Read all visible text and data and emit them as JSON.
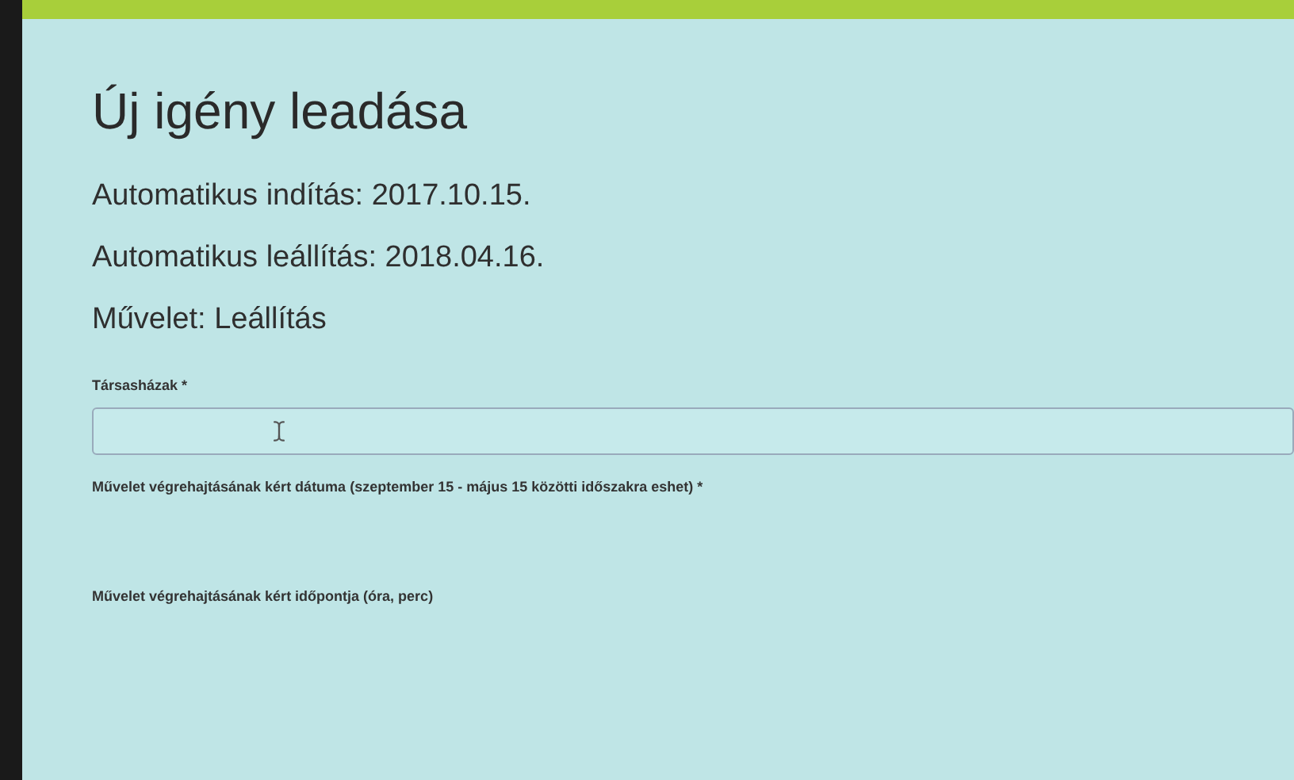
{
  "page": {
    "title": "Új igény leadása"
  },
  "info_lines": [
    "Automatikus indítás: 2017.10.15.",
    "Automatikus leállítás: 2018.04.16.",
    "Művelet: Leállítás"
  ],
  "fields": [
    {
      "label": "Társasházak *",
      "kind": "input"
    },
    {
      "label": "Művelet végrehajtásának kért dátuma (szeptember 15 - május 15 közötti időszakra eshet) *",
      "kind": "blank"
    },
    {
      "label": "Művelet végrehajtásának kért időpontja (óra, perc)",
      "kind": "blank"
    }
  ]
}
